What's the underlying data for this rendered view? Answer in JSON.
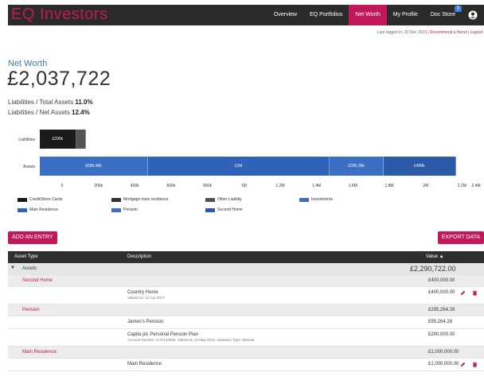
{
  "app": {
    "logo": "EQ Investors",
    "nav": [
      {
        "label": "Overview",
        "active": false
      },
      {
        "label": "EQ Portfolios",
        "active": false
      },
      {
        "label": "Net Worth",
        "active": true
      },
      {
        "label": "My Profile",
        "active": false
      },
      {
        "label": "Doc Store",
        "active": false
      }
    ],
    "doc_store_badge": "3",
    "last_logged_in": "Last logged in: 20 Dec 2019 |",
    "recommend_link": "Recommend a friend",
    "separator": " | ",
    "logout_link": "Logout"
  },
  "summary": {
    "title": "Net Worth",
    "value": "£2,037,722",
    "ratio1_label": "Liabilities / Total Assets",
    "ratio1_value": "11.0%",
    "ratio2_label": "Liabilities / Net Assets",
    "ratio2_value": "12.4%"
  },
  "chart_data": {
    "type": "bar",
    "orientation": "horizontal-stacked",
    "categories": [
      "Liabilities",
      "Assets"
    ],
    "series": [
      {
        "name": "Credit/Store Cards",
        "color": "#1a1a1a",
        "values": [
          200000,
          0
        ],
        "label": "£200k"
      },
      {
        "name": "Other Liability",
        "color": "#555555",
        "values": [
          53000,
          0
        ],
        "label": ""
      },
      {
        "name": "Pension",
        "color": "#3a6fc4",
        "values": [
          0,
          595460
        ],
        "label": "£595.46k"
      },
      {
        "name": "Main Residence",
        "color": "#2f62b8",
        "values": [
          0,
          1000000
        ],
        "label": "£1M"
      },
      {
        "name": "Investments",
        "color": "#3a6fc4",
        "values": [
          0,
          295260
        ],
        "label": "£295.26k"
      },
      {
        "name": "Second Home",
        "color": "#2b5aa8",
        "values": [
          0,
          400000
        ],
        "label": "£400k"
      }
    ],
    "x_ticks": [
      "0",
      "200k",
      "400k",
      "600k",
      "800k",
      "1M",
      "1.2M",
      "1.4M",
      "1.6M",
      "1.8M",
      "2M",
      "2.2M",
      "2.4M"
    ],
    "xlim": [
      0,
      2400000
    ],
    "legend": [
      {
        "label": "Credit/Store Cards",
        "color": "#1a1a1a"
      },
      {
        "label": "Mortgage main residence",
        "color": "#333333"
      },
      {
        "label": "Other Liability",
        "color": "#555555"
      },
      {
        "label": "Investments",
        "color": "#3a6fc4"
      },
      {
        "label": "Main Residence",
        "color": "#2f62b8"
      },
      {
        "label": "Pension",
        "color": "#3a6fc4"
      },
      {
        "label": "Second Home",
        "color": "#2b5aa8"
      }
    ],
    "legend_position": "bottom-left"
  },
  "actions": {
    "add_entry": "ADD AN ENTRY",
    "export": "EXPORT DATA"
  },
  "table": {
    "headers": {
      "type": "Asset Type",
      "description": "Description",
      "value": "Value ▲"
    },
    "group": {
      "label": "Assets",
      "value": "£2,290,722.00"
    },
    "rows": [
      {
        "kind": "sub",
        "name": "Second Home",
        "value": "£400,000.00"
      },
      {
        "kind": "item",
        "desc": "Country Home",
        "detail": "Valued on: 12 Apr 2017",
        "value": "£400,000.00",
        "actions": true
      },
      {
        "kind": "sub",
        "name": "Pension",
        "value": "£295,264.28"
      },
      {
        "kind": "item",
        "desc": "James's Pension",
        "detail": "",
        "value": "£95,264.28",
        "actions": false
      },
      {
        "kind": "item",
        "desc": "Capita plc Personal Pension Plan",
        "detail": "Account Number: CAP123456, Valued at: 12 May 2016, Valuation Type: Manual",
        "value": "£200,000.00",
        "actions": false
      },
      {
        "kind": "sub",
        "name": "Main Residence",
        "value": "£1,000,000.00"
      },
      {
        "kind": "item",
        "desc": "Main Residence",
        "detail": "",
        "value": "£1,000,000.00",
        "actions": true
      }
    ]
  },
  "colors": {
    "brand": "#c2185b",
    "dark": "#2b2b2b",
    "title_blue": "#3a7abf"
  }
}
